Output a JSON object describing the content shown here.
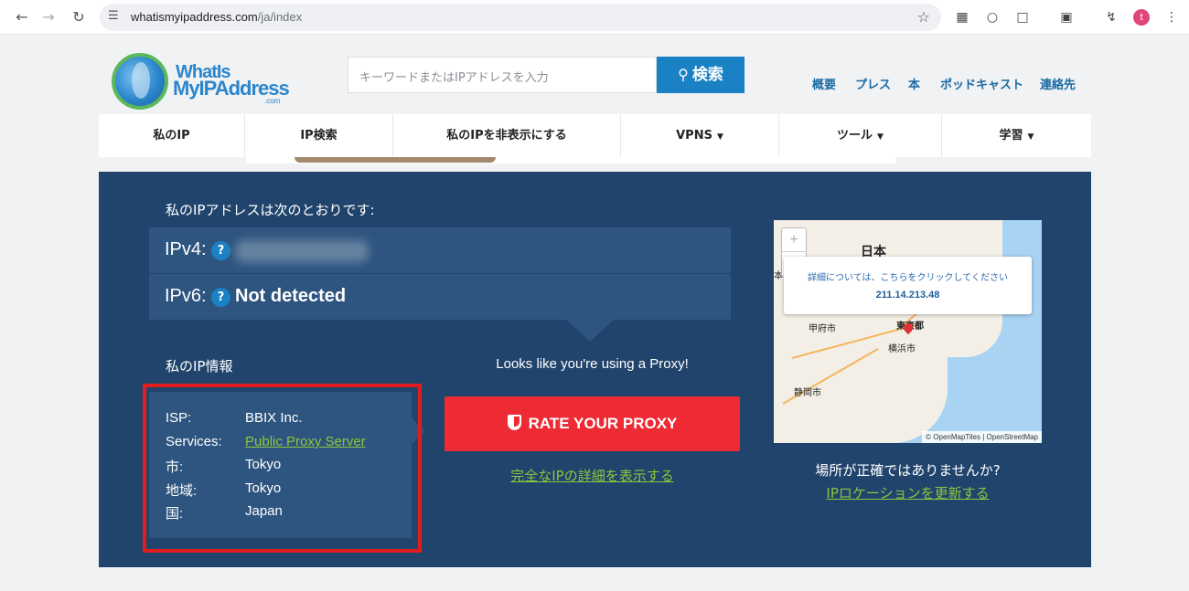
{
  "browser": {
    "url_host": "whatismyipaddress.com",
    "url_path": "/ja/index",
    "profile_initial": "t"
  },
  "header": {
    "logo_line1": "WhatIs",
    "logo_line2": "MyIPAddress",
    "logo_com": ".com",
    "search_placeholder": "キーワードまたはIPアドレスを入力",
    "search_button": "検索",
    "top_links": [
      "概要",
      "プレス",
      "本",
      "ポッドキャスト",
      "連絡先"
    ]
  },
  "nav": {
    "items": [
      {
        "label": "私のIP",
        "dropdown": false
      },
      {
        "label": "IP検索",
        "dropdown": false
      },
      {
        "label": "私のIPを非表示にする",
        "dropdown": false
      },
      {
        "label": "VPNS",
        "dropdown": true
      },
      {
        "label": "ツール",
        "dropdown": true
      },
      {
        "label": "学習",
        "dropdown": true
      }
    ]
  },
  "main": {
    "title": "私のIPアドレスは次のとおりです:",
    "ipv4_label": "IPv4:",
    "ipv6_label": "IPv6:",
    "ipv6_value": "Not detected",
    "help": "?",
    "info_title": "私のIP情報",
    "info": [
      {
        "label": "ISP:",
        "value": "BBIX Inc.",
        "link": false
      },
      {
        "label": "Services:",
        "value": "Public Proxy Server",
        "link": true
      },
      {
        "label": "市:",
        "value": "Tokyo",
        "link": false
      },
      {
        "label": "地域:",
        "value": "Tokyo",
        "link": false
      },
      {
        "label": "国:",
        "value": "Japan",
        "link": false
      }
    ],
    "proxy_message": "Looks like you're using a Proxy!",
    "rate_button": "RATE YOUR PROXY",
    "details_link": "完全なIPの詳細を表示する"
  },
  "map": {
    "zoom_in": "+",
    "zoom_out": "−",
    "popup_text": "詳細については、こちらをクリックしてください",
    "popup_ip": "211.14.213.48",
    "labels": {
      "country": "日本",
      "edge": "本",
      "kofu": "甲府市",
      "tokyo": "東京都",
      "yokohama": "横浜市",
      "shizuoka": "静岡市"
    },
    "attribution": "© OpenMapTiles | OpenStreetMap"
  },
  "location": {
    "question": "場所が正確ではありませんか?",
    "update_link": "IPロケーションを更新する"
  },
  "colors": {
    "panel": "#21446c",
    "row": "#2e557f",
    "accent_blue": "#1a81c4",
    "link_green": "#8cc63f",
    "button_red": "#ee2a34",
    "highlight_red": "#e31c1c"
  }
}
